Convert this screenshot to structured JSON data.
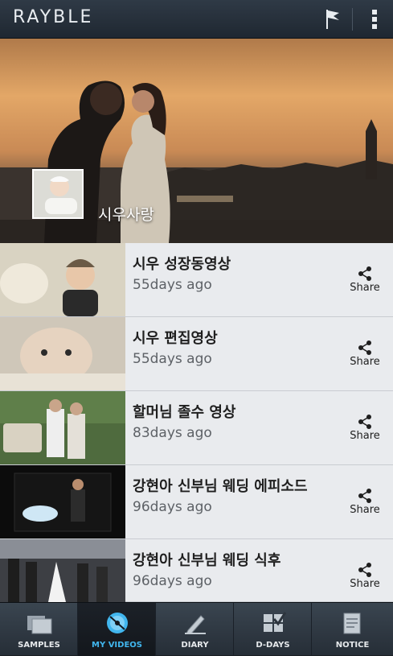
{
  "app": {
    "logo": "RAYBLE"
  },
  "header": {
    "flag_icon": "flag-icon",
    "menu_icon": "overflow-menu-icon"
  },
  "hero": {
    "title": "시우사랑"
  },
  "videos": [
    {
      "title": "시우 성장동영상",
      "date": "55days ago",
      "share_label": "Share"
    },
    {
      "title": "시우 편집영상",
      "date": "55days ago",
      "share_label": "Share"
    },
    {
      "title": "할머님 졸수 영상",
      "date": "83days ago",
      "share_label": "Share"
    },
    {
      "title": "강현아 신부님 웨딩 에피소드",
      "date": "96days ago",
      "share_label": "Share"
    },
    {
      "title": "강현아 신부님 웨딩 식후",
      "date": "96days ago",
      "share_label": "Share"
    }
  ],
  "nav": [
    {
      "label": "SAMPLES",
      "icon": "folder-icon",
      "active": false
    },
    {
      "label": "MY VIDEOS",
      "icon": "disc-icon",
      "active": true
    },
    {
      "label": "DIARY",
      "icon": "pencil-icon",
      "active": false
    },
    {
      "label": "D-DAYS",
      "icon": "calendar-check-icon",
      "active": false
    },
    {
      "label": "NOTICE",
      "icon": "notice-icon",
      "active": false
    }
  ],
  "colors": {
    "accent": "#41b6ee",
    "list_bg": "#e9ebee",
    "bar": "#2b3540"
  }
}
